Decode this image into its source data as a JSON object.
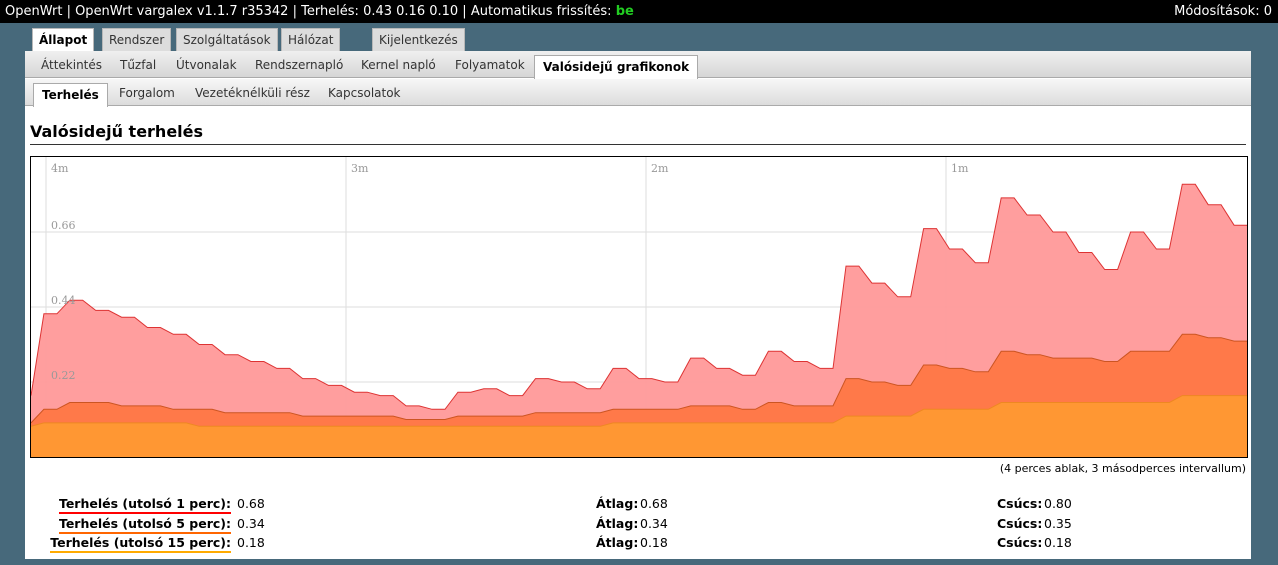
{
  "header": {
    "title": "OpenWrt | OpenWrt vargalex v1.1.7 r35342 | Terhelés: 0.43 0.16 0.10 | Automatikus frissítés:",
    "refresh_state": "be",
    "changes": "Módosítások: 0"
  },
  "tabs_main": [
    "Állapot",
    "Rendszer",
    "Szolgáltatások",
    "Hálózat",
    "Kijelentkezés"
  ],
  "tabs_status": [
    "Áttekintés",
    "Tűzfal",
    "Útvonalak",
    "Rendszernapló",
    "Kernel napló",
    "Folyamatok",
    "Valósidejű grafikonok"
  ],
  "tabs_realtime": [
    "Terhelés",
    "Forgalom",
    "Vezetéknélküli rész",
    "Kapcsolatok"
  ],
  "page_title": "Valósidejű terhelés",
  "chart_caption": "(4 perces ablak, 3 másodperces intervallum)",
  "chart_data": {
    "type": "area",
    "x_tick_labels": [
      "4m",
      "3m",
      "2m",
      "1m"
    ],
    "y_tick_labels": [
      "0.22",
      "0.44",
      "0.66"
    ],
    "ylim": [
      0,
      0.88
    ],
    "grid": true,
    "x_step_seconds": 3,
    "series": [
      {
        "name": "Terhelés (utolsó 1 perc)",
        "color": "#ff9999",
        "stroke": "#dd3333",
        "values": [
          0.18,
          0.42,
          0.42,
          0.46,
          0.46,
          0.43,
          0.43,
          0.41,
          0.41,
          0.38,
          0.38,
          0.36,
          0.36,
          0.33,
          0.33,
          0.3,
          0.3,
          0.28,
          0.28,
          0.26,
          0.26,
          0.23,
          0.23,
          0.21,
          0.21,
          0.19,
          0.19,
          0.18,
          0.18,
          0.15,
          0.15,
          0.14,
          0.14,
          0.19,
          0.19,
          0.2,
          0.2,
          0.18,
          0.18,
          0.23,
          0.23,
          0.22,
          0.22,
          0.2,
          0.2,
          0.26,
          0.26,
          0.23,
          0.23,
          0.22,
          0.22,
          0.29,
          0.29,
          0.26,
          0.26,
          0.24,
          0.24,
          0.31,
          0.31,
          0.28,
          0.28,
          0.26,
          0.26,
          0.56,
          0.56,
          0.51,
          0.51,
          0.47,
          0.47,
          0.67,
          0.67,
          0.61,
          0.61,
          0.57,
          0.57,
          0.76,
          0.76,
          0.71,
          0.71,
          0.66,
          0.66,
          0.6,
          0.6,
          0.55,
          0.55,
          0.66,
          0.66,
          0.61,
          0.61,
          0.8,
          0.8,
          0.74,
          0.74,
          0.68,
          0.68
        ]
      },
      {
        "name": "Terhelés (utolsó 5 perc)",
        "color": "#ff7744",
        "stroke": "#cc5522",
        "values": [
          0.1,
          0.14,
          0.14,
          0.16,
          0.16,
          0.16,
          0.16,
          0.15,
          0.15,
          0.15,
          0.15,
          0.14,
          0.14,
          0.14,
          0.14,
          0.13,
          0.13,
          0.13,
          0.13,
          0.13,
          0.13,
          0.12,
          0.12,
          0.12,
          0.12,
          0.12,
          0.12,
          0.12,
          0.12,
          0.11,
          0.11,
          0.11,
          0.11,
          0.12,
          0.12,
          0.12,
          0.12,
          0.12,
          0.12,
          0.13,
          0.13,
          0.13,
          0.13,
          0.13,
          0.13,
          0.14,
          0.14,
          0.14,
          0.14,
          0.14,
          0.14,
          0.15,
          0.15,
          0.15,
          0.15,
          0.14,
          0.14,
          0.16,
          0.16,
          0.15,
          0.15,
          0.15,
          0.15,
          0.23,
          0.23,
          0.22,
          0.22,
          0.21,
          0.21,
          0.27,
          0.27,
          0.26,
          0.26,
          0.25,
          0.25,
          0.31,
          0.31,
          0.3,
          0.3,
          0.29,
          0.29,
          0.29,
          0.29,
          0.28,
          0.28,
          0.31,
          0.31,
          0.31,
          0.31,
          0.36,
          0.36,
          0.35,
          0.35,
          0.34,
          0.34
        ]
      },
      {
        "name": "Terhelés (utolsó 15 perc)",
        "color": "#ff9933",
        "stroke": "#ee8822",
        "values": [
          0.09,
          0.1,
          0.1,
          0.1,
          0.1,
          0.1,
          0.1,
          0.1,
          0.1,
          0.1,
          0.1,
          0.1,
          0.1,
          0.09,
          0.09,
          0.09,
          0.09,
          0.09,
          0.09,
          0.09,
          0.09,
          0.09,
          0.09,
          0.09,
          0.09,
          0.09,
          0.09,
          0.09,
          0.09,
          0.09,
          0.09,
          0.09,
          0.09,
          0.09,
          0.09,
          0.09,
          0.09,
          0.09,
          0.09,
          0.09,
          0.09,
          0.09,
          0.09,
          0.09,
          0.09,
          0.1,
          0.1,
          0.1,
          0.1,
          0.1,
          0.1,
          0.1,
          0.1,
          0.1,
          0.1,
          0.1,
          0.1,
          0.1,
          0.1,
          0.1,
          0.1,
          0.1,
          0.1,
          0.12,
          0.12,
          0.12,
          0.12,
          0.12,
          0.12,
          0.14,
          0.14,
          0.14,
          0.14,
          0.14,
          0.14,
          0.16,
          0.16,
          0.16,
          0.16,
          0.16,
          0.16,
          0.16,
          0.16,
          0.16,
          0.16,
          0.16,
          0.16,
          0.16,
          0.16,
          0.18,
          0.18,
          0.18,
          0.18,
          0.18,
          0.18
        ]
      }
    ]
  },
  "stats": [
    {
      "label": "Terhelés (utolsó 1 perc):",
      "color": "#ff0000",
      "value": "0.68",
      "avg_label": "Átlag:",
      "avg": "0.68",
      "peak_label": "Csúcs:",
      "peak": "0.80"
    },
    {
      "label": "Terhelés (utolsó 5 perc):",
      "color": "#ff6600",
      "value": "0.34",
      "avg_label": "Átlag:",
      "avg": "0.34",
      "peak_label": "Csúcs:",
      "peak": "0.35"
    },
    {
      "label": "Terhelés (utolsó 15 perc):",
      "color": "#ffaa00",
      "value": "0.18",
      "avg_label": "Átlag:",
      "avg": "0.18",
      "peak_label": "Csúcs:",
      "peak": "0.18"
    }
  ]
}
